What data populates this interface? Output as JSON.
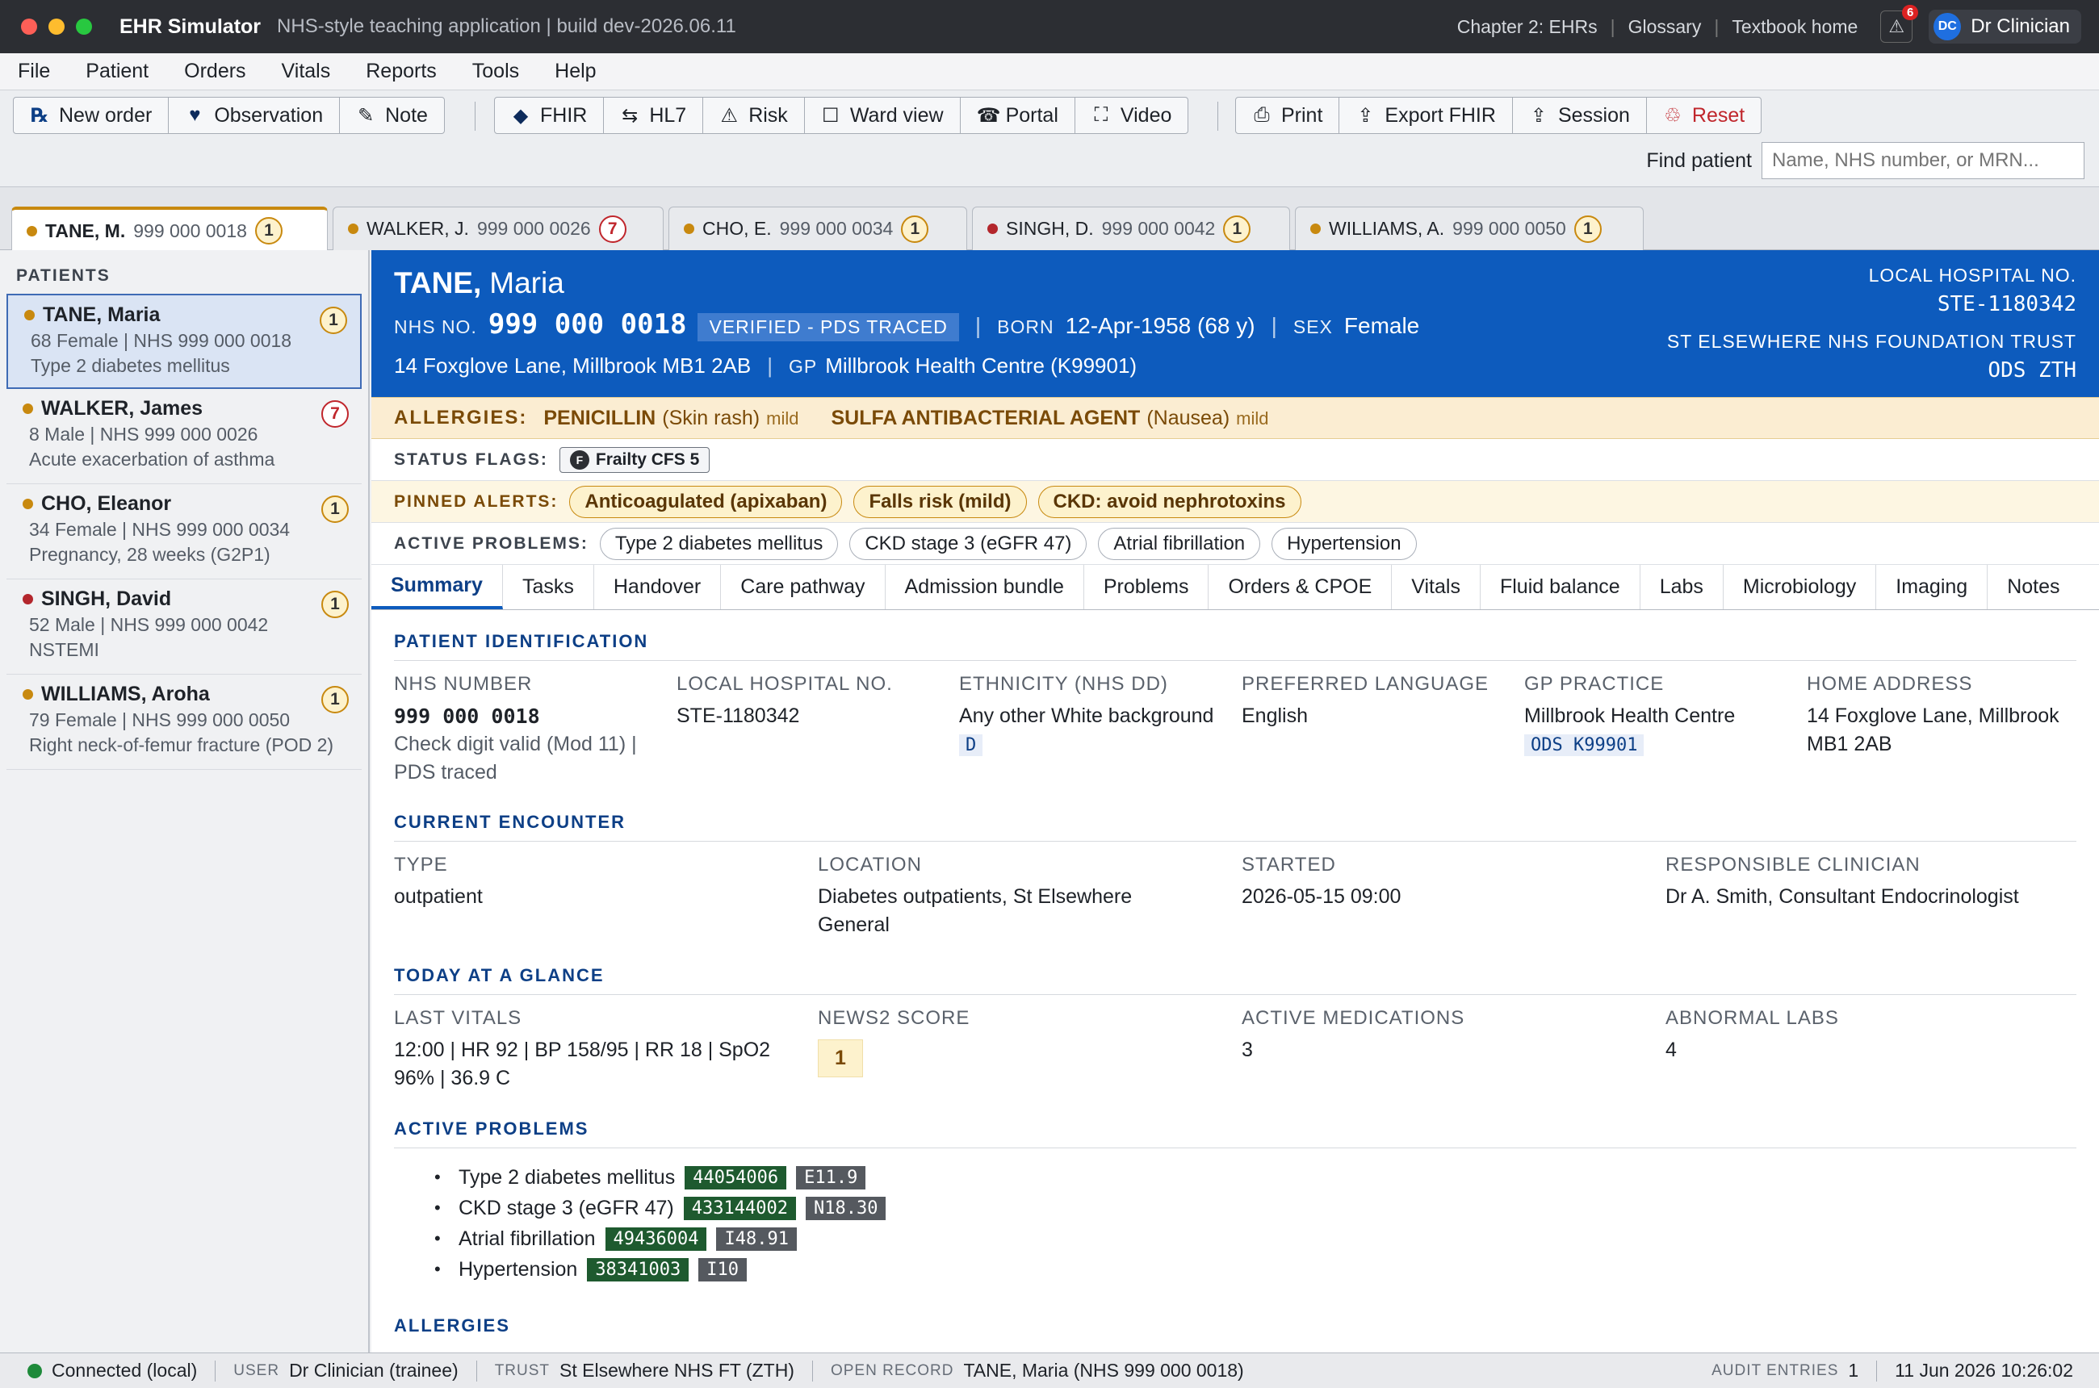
{
  "titlebar": {
    "app_name": "EHR Simulator",
    "subtitle": "NHS-style teaching application | build dev-2026.06.11",
    "links": [
      "Chapter 2: EHRs",
      "Glossary",
      "Textbook home"
    ],
    "alert_count": "6",
    "user_initials": "DC",
    "user_name": "Dr Clinician"
  },
  "menu": [
    "File",
    "Patient",
    "Orders",
    "Vitals",
    "Reports",
    "Tools",
    "Help"
  ],
  "toolbar": {
    "group1": [
      {
        "icon": "prescription-icon",
        "glyph": "℞",
        "label": "New order"
      },
      {
        "icon": "heart-icon",
        "glyph": "♥",
        "label": "Observation"
      },
      {
        "icon": "pencil-icon",
        "glyph": "✎",
        "label": "Note"
      }
    ],
    "group2": [
      {
        "icon": "fhir-icon",
        "glyph": "◆",
        "label": "FHIR"
      },
      {
        "icon": "swap-icon",
        "glyph": "⇆",
        "label": "HL7"
      },
      {
        "icon": "warning-icon",
        "glyph": "⚠",
        "label": "Risk"
      },
      {
        "icon": "square-icon",
        "glyph": "☐",
        "label": "Ward view"
      },
      {
        "icon": "portal-icon",
        "glyph": "☎",
        "label": "Portal"
      },
      {
        "icon": "video-icon",
        "glyph": "⛶",
        "label": "Video"
      }
    ],
    "group3": [
      {
        "icon": "print-icon",
        "glyph": "⎙",
        "label": "Print",
        "color": "#1e2228"
      },
      {
        "icon": "export-icon",
        "glyph": "⇪",
        "label": "Export FHIR",
        "color": "#1e2228"
      },
      {
        "icon": "session-icon",
        "glyph": "⇪",
        "label": "Session",
        "color": "#1e2228"
      },
      {
        "icon": "reset-icon",
        "glyph": "♲",
        "label": "Reset",
        "color": "#c0262c"
      }
    ],
    "find_label": "Find patient",
    "find_placeholder": "Name, NHS number, or MRN..."
  },
  "tabs": [
    {
      "name": "TANE, M.",
      "nhs": "999 000 0018",
      "count": "1",
      "dot": "#c8890f",
      "badge": "y"
    },
    {
      "name": "WALKER, J.",
      "nhs": "999 000 0026",
      "count": "7",
      "dot": "#c8890f",
      "badge": "r"
    },
    {
      "name": "CHO, E.",
      "nhs": "999 000 0034",
      "count": "1",
      "dot": "#c8890f",
      "badge": "y"
    },
    {
      "name": "SINGH, D.",
      "nhs": "999 000 0042",
      "count": "1",
      "dot": "#b3262c",
      "badge": "y"
    },
    {
      "name": "WILLIAMS, A.",
      "nhs": "999 000 0050",
      "count": "1",
      "dot": "#c8890f",
      "badge": "y"
    }
  ],
  "sidebar": {
    "heading": "PATIENTS",
    "patients": [
      {
        "name": "TANE, Maria",
        "line1": "68 Female | NHS 999 000 0018",
        "line2": "Type 2 diabetes mellitus",
        "count": "1",
        "dot": "#c8890f",
        "badge": "y"
      },
      {
        "name": "WALKER, James",
        "line1": "8 Male | NHS 999 000 0026",
        "line2": "Acute exacerbation of asthma",
        "count": "7",
        "dot": "#c8890f",
        "badge": "r"
      },
      {
        "name": "CHO, Eleanor",
        "line1": "34 Female | NHS 999 000 0034",
        "line2": "Pregnancy, 28 weeks (G2P1)",
        "count": "1",
        "dot": "#c8890f",
        "badge": "y"
      },
      {
        "name": "SINGH, David",
        "line1": "52 Male | NHS 999 000 0042",
        "line2": "NSTEMI",
        "count": "1",
        "dot": "#b3262c",
        "badge": "y"
      },
      {
        "name": "WILLIAMS, Aroha",
        "line1": "79 Female | NHS 999 000 0050",
        "line2": "Right neck-of-femur fracture (POD 2)",
        "count": "1",
        "dot": "#c8890f",
        "badge": "y"
      }
    ]
  },
  "banner": {
    "surname": "TANE,",
    "given": "Maria",
    "nhs_label": "NHS NO.",
    "nhs_number": "999 000 0018",
    "verified": "VERIFIED - PDS TRACED",
    "born_label": "BORN",
    "born": "12-Apr-1958 (68 y)",
    "sex_label": "SEX",
    "sex": "Female",
    "address": "14 Foxglove Lane, Millbrook MB1 2AB",
    "gp_label": "GP",
    "gp": "Millbrook Health Centre (K99901)",
    "local_label": "LOCAL HOSPITAL NO.",
    "local_no": "STE-1180342",
    "trust": "ST ELSEWHERE NHS FOUNDATION TRUST",
    "ods": "ODS ZTH"
  },
  "allergies_strip": {
    "label": "ALLERGIES:",
    "items": [
      {
        "agent": "PENICILLIN",
        "reaction": "(Skin rash)",
        "severity": "mild"
      },
      {
        "agent": "SULFA ANTIBACTERIAL AGENT",
        "reaction": "(Nausea)",
        "severity": "mild"
      }
    ]
  },
  "status_flags": {
    "label": "STATUS FLAGS:",
    "flag_letter": "F",
    "flag": "Frailty CFS 5"
  },
  "pinned_alerts": {
    "label": "PINNED ALERTS:",
    "items": [
      "Anticoagulated (apixaban)",
      "Falls risk (mild)",
      "CKD: avoid nephrotoxins"
    ]
  },
  "active_problems_strip": {
    "label": "ACTIVE PROBLEMS:",
    "items": [
      "Type 2 diabetes mellitus",
      "CKD stage 3 (eGFR 47)",
      "Atrial fibrillation",
      "Hypertension"
    ]
  },
  "clinical_tabs": [
    "Summary",
    "Tasks",
    "Handover",
    "Care pathway",
    "Admission bundle",
    "Problems",
    "Orders & CPOE",
    "Vitals",
    "Fluid balance",
    "Labs",
    "Microbiology",
    "Imaging",
    "Notes"
  ],
  "summary": {
    "identification": {
      "heading": "PATIENT IDENTIFICATION",
      "nhs_label": "NHS NUMBER",
      "nhs_value": "999 000 0018",
      "nhs_note": "Check digit valid (Mod 11) | PDS traced",
      "local_label": "LOCAL HOSPITAL NO.",
      "local_value": "STE-1180342",
      "ethnicity_label": "ETHNICITY (NHS DD)",
      "ethnicity_value": "Any other White background",
      "ethnicity_code": "D",
      "language_label": "PREFERRED LANGUAGE",
      "language_value": "English",
      "gp_label": "GP PRACTICE",
      "gp_value": "Millbrook Health Centre",
      "gp_code": "ODS K99901",
      "address_label": "HOME ADDRESS",
      "address_value": "14 Foxglove Lane, Millbrook MB1 2AB"
    },
    "encounter": {
      "heading": "CURRENT ENCOUNTER",
      "type_label": "TYPE",
      "type_value": "outpatient",
      "location_label": "LOCATION",
      "location_value": "Diabetes outpatients, St Elsewhere General",
      "started_label": "STARTED",
      "started_value": "2026-05-15 09:00",
      "clinician_label": "RESPONSIBLE CLINICIAN",
      "clinician_value": "Dr A. Smith, Consultant Endocrinologist"
    },
    "glance": {
      "heading": "TODAY AT A GLANCE",
      "vitals_label": "LAST VITALS",
      "vitals_value": "12:00 | HR 92 | BP 158/95 | RR 18 | SpO2 96% | 36.9 C",
      "news_label": "NEWS2 SCORE",
      "news_value": "1",
      "meds_label": "ACTIVE MEDICATIONS",
      "meds_value": "3",
      "labs_label": "ABNORMAL LABS",
      "labs_value": "4"
    },
    "problems": {
      "heading": "ACTIVE PROBLEMS",
      "items": [
        {
          "name": "Type 2 diabetes mellitus",
          "snomed": "44054006",
          "icd": "E11.9"
        },
        {
          "name": "CKD stage 3 (eGFR 47)",
          "snomed": "433144002",
          "icd": "N18.30"
        },
        {
          "name": "Atrial fibrillation",
          "snomed": "49436004",
          "icd": "I48.91"
        },
        {
          "name": "Hypertension",
          "snomed": "38341003",
          "icd": "I10"
        }
      ]
    },
    "allergies_heading": "ALLERGIES"
  },
  "statusbar": {
    "connection": "Connected (local)",
    "user_label": "USER",
    "user": "Dr Clinician (trainee)",
    "trust_label": "TRUST",
    "trust": "St Elsewhere NHS FT (ZTH)",
    "record_label": "OPEN RECORD",
    "record": "TANE, Maria (NHS 999 000 0018)",
    "audit_label": "AUDIT ENTRIES",
    "audit": "1",
    "datetime": "11 Jun 2026 10:26:02"
  }
}
